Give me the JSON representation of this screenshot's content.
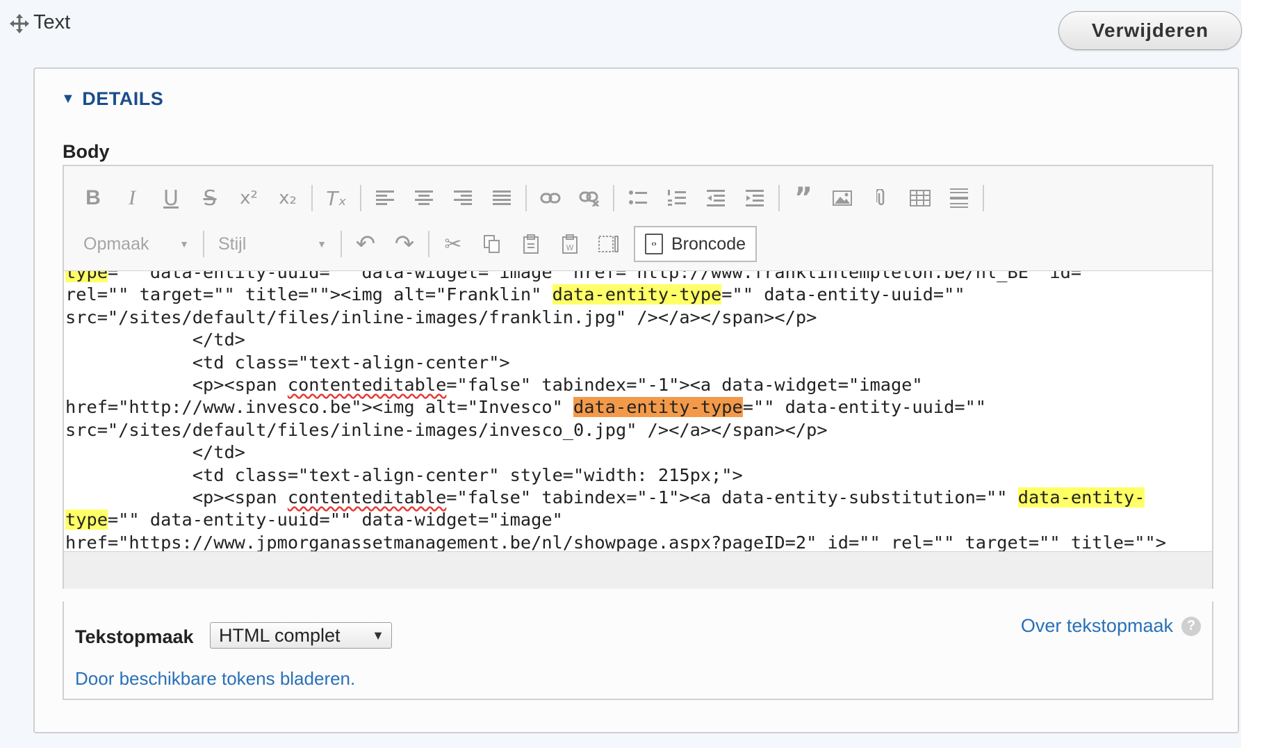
{
  "paragraph": {
    "title": "Text",
    "remove_label": "Verwijderen"
  },
  "details": {
    "summary": "DETAILS",
    "field_label": "Body"
  },
  "toolbar": {
    "row1": [
      "bold",
      "italic",
      "underline",
      "strike",
      "superscript",
      "subscript",
      "remove-format",
      "align-left",
      "align-center",
      "align-right",
      "justify",
      "link",
      "unlink",
      "bulleted-list",
      "numbered-list",
      "outdent",
      "indent",
      "blockquote",
      "image",
      "file",
      "table",
      "horizontal-rule"
    ],
    "format_placeholder": "Opmaak",
    "style_placeholder": "Stijl",
    "source_label": "Broncode"
  },
  "source": {
    "lines": [
      [
        [
          "type",
          "y"
        ],
        [
          "=\"\" data-entity-uuid=\"\" data-widget=\"image\" href=\"http://www.franklintempleton.be/nl_BE\" id=\"\"",
          ""
        ]
      ],
      [
        [
          "rel=\"\" target=\"\" title=\"\"><img alt=\"Franklin\" ",
          ""
        ],
        [
          "data-entity-type",
          "y"
        ],
        [
          "=\"\" data-entity-uuid=\"\"",
          ""
        ]
      ],
      [
        [
          "src=\"/sites/default/files/inline-images/franklin.jpg\" /></a></span></p>",
          ""
        ]
      ],
      [
        [
          "            </td>",
          ""
        ]
      ],
      [
        [
          "            <td class=\"text-align-center\">",
          ""
        ]
      ],
      [
        [
          "            <p><span ",
          ""
        ],
        [
          "contenteditable",
          "s"
        ],
        [
          "=\"false\" tabindex=\"-1\"><a data-widget=\"image\"",
          ""
        ]
      ],
      [
        [
          "href=\"http://www.invesco.be\"><img alt=\"Invesco\" ",
          ""
        ],
        [
          "data-entity-type",
          "o"
        ],
        [
          "=\"\" data-entity-uuid=\"\"",
          ""
        ]
      ],
      [
        [
          "src=\"/sites/default/files/inline-images/invesco_0.jpg\" /></a></span></p>",
          ""
        ]
      ],
      [
        [
          "            </td>",
          ""
        ]
      ],
      [
        [
          "            <td class=\"text-align-center\" style=\"width: 215px;\">",
          ""
        ]
      ],
      [
        [
          "            <p><span ",
          ""
        ],
        [
          "contenteditable",
          "s"
        ],
        [
          "=\"false\" tabindex=\"-1\"><a data-entity-substitution=\"\" ",
          ""
        ],
        [
          "data-entity-",
          "y"
        ]
      ],
      [
        [
          "type",
          "y"
        ],
        [
          "=\"\" data-entity-uuid=\"\" data-widget=\"image\"",
          ""
        ]
      ],
      [
        [
          "href=\"https://www.jpmorganassetmanagement.be/nl/showpage.aspx?pageID=2\" id=\"\" rel=\"\" target=\"\" title=\"\">",
          ""
        ]
      ]
    ]
  },
  "text_format": {
    "label": "Tekstopmaak",
    "selected": "HTML complet",
    "help_link": "Over tekstopmaak",
    "tokens_link": "Door beschikbare tokens bladeren."
  }
}
